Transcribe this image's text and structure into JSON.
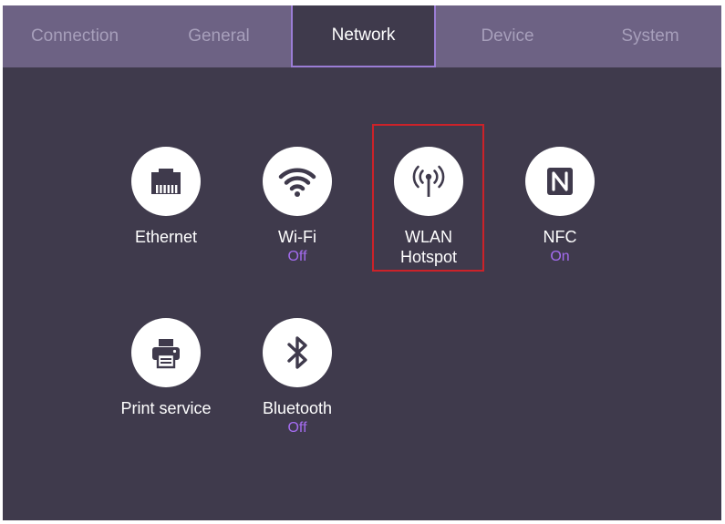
{
  "tabs": [
    {
      "label": "Connection",
      "active": false
    },
    {
      "label": "General",
      "active": false
    },
    {
      "label": "Network",
      "active": true
    },
    {
      "label": "Device",
      "active": false
    },
    {
      "label": "System",
      "active": false
    }
  ],
  "network_items": [
    {
      "label": "Ethernet",
      "status": "",
      "icon": "ethernet-icon"
    },
    {
      "label": "Wi-Fi",
      "status": "Off",
      "icon": "wifi-icon"
    },
    {
      "label": "WLAN\nHotspot",
      "status": "",
      "icon": "wlan-hotspot-icon",
      "highlighted": true
    },
    {
      "label": "NFC",
      "status": "On",
      "icon": "nfc-icon"
    },
    {
      "label": "Print service",
      "status": "",
      "icon": "printer-icon"
    },
    {
      "label": "Bluetooth",
      "status": "Off",
      "icon": "bluetooth-icon"
    }
  ],
  "colors": {
    "background": "#3f3a4c",
    "tab_bar": "#6d6284",
    "active_accent": "#9b7dd6",
    "status_text": "#a46cf0",
    "highlight_border": "#cc2229"
  }
}
